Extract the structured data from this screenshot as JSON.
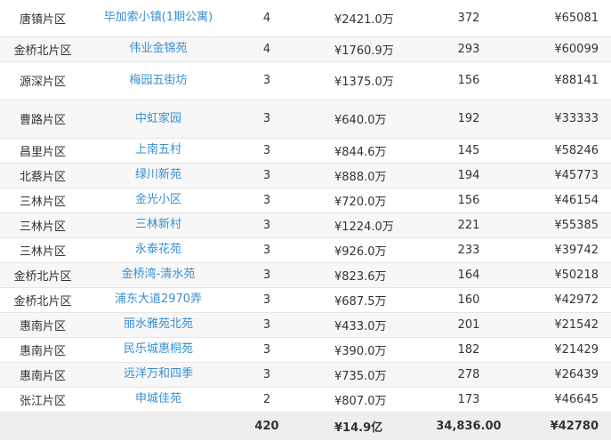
{
  "rows": [
    {
      "district": "唐镇片区",
      "community": "毕加索小镇(1期公寓)",
      "deals": "4",
      "amount": "¥2421.0万",
      "area": "372",
      "avg_price": "¥65081",
      "h": 41
    },
    {
      "district": "金桥北片区",
      "community": "伟业金锦苑",
      "deals": "4",
      "amount": "¥1760.9万",
      "area": "293",
      "avg_price": "¥60099",
      "h": 28
    },
    {
      "district": "源深片区",
      "community": "梅园五街坊",
      "deals": "3",
      "amount": "¥1375.0万",
      "area": "156",
      "avg_price": "¥88141",
      "h": 43
    },
    {
      "district": "曹路片区",
      "community": "中虹家园",
      "deals": "3",
      "amount": "¥640.0万",
      "area": "192",
      "avg_price": "¥33333",
      "h": 43
    },
    {
      "district": "昌里片区",
      "community": "上南五村",
      "deals": "3",
      "amount": "¥844.6万",
      "area": "145",
      "avg_price": "¥58246",
      "h": 28
    },
    {
      "district": "北蔡片区",
      "community": "绿川新苑",
      "deals": "3",
      "amount": "¥888.0万",
      "area": "194",
      "avg_price": "¥45773",
      "h": 28
    },
    {
      "district": "三林片区",
      "community": "金光小区",
      "deals": "3",
      "amount": "¥720.0万",
      "area": "156",
      "avg_price": "¥46154",
      "h": 28
    },
    {
      "district": "三林片区",
      "community": "三林新村",
      "deals": "3",
      "amount": "¥1224.0万",
      "area": "221",
      "avg_price": "¥55385",
      "h": 28
    },
    {
      "district": "三林片区",
      "community": "永泰花苑",
      "deals": "3",
      "amount": "¥926.0万",
      "area": "233",
      "avg_price": "¥39742",
      "h": 28
    },
    {
      "district": "金桥北片区",
      "community": "金桥湾-清水苑",
      "deals": "3",
      "amount": "¥823.6万",
      "area": "164",
      "avg_price": "¥50218",
      "h": 28
    },
    {
      "district": "金桥北片区",
      "community": "浦东大道2970弄",
      "deals": "3",
      "amount": "¥687.5万",
      "area": "160",
      "avg_price": "¥42972",
      "h": 28
    },
    {
      "district": "惠南片区",
      "community": "丽水雅苑北苑",
      "deals": "3",
      "amount": "¥433.0万",
      "area": "201",
      "avg_price": "¥21542",
      "h": 28
    },
    {
      "district": "惠南片区",
      "community": "民乐城惠桐苑",
      "deals": "3",
      "amount": "¥390.0万",
      "area": "182",
      "avg_price": "¥21429",
      "h": 28
    },
    {
      "district": "惠南片区",
      "community": "远洋万和四季",
      "deals": "3",
      "amount": "¥735.0万",
      "area": "278",
      "avg_price": "¥26439",
      "h": 28
    },
    {
      "district": "张江片区",
      "community": "申城佳苑",
      "deals": "2",
      "amount": "¥807.0万",
      "area": "173",
      "avg_price": "¥46645",
      "h": 28
    }
  ],
  "total": {
    "district": "",
    "community": "",
    "deals": "420",
    "amount": "¥14.9亿",
    "area": "34,836.00",
    "avg_price": "¥42780"
  }
}
